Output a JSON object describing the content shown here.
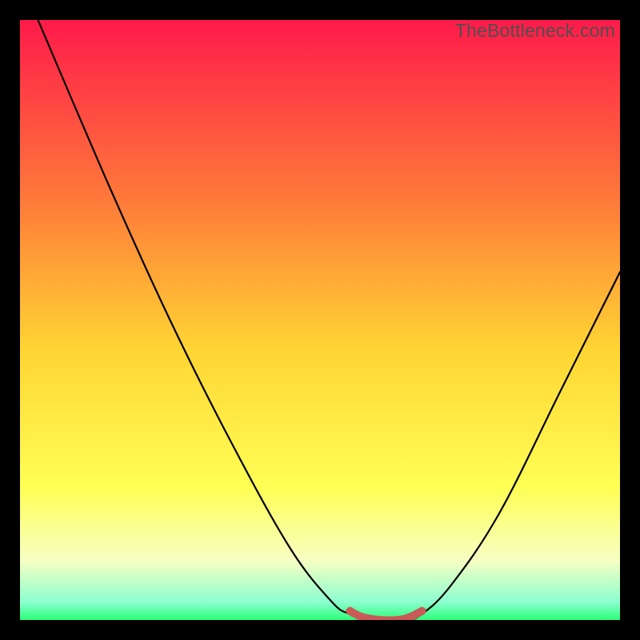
{
  "watermark": "TheBottleneck.com",
  "colors": {
    "frame": "#000000",
    "gradient_top": "#ff1a4a",
    "gradient_mid_upper": "#ff7a3a",
    "gradient_mid": "#ffd533",
    "gradient_mid_lower": "#ffff55",
    "gradient_lower": "#f7ffc2",
    "gradient_bottom": "#2cff79",
    "curve": "#000000",
    "marker": "#c85a57"
  },
  "chart_data": {
    "type": "line",
    "title": "",
    "xlabel": "",
    "ylabel": "",
    "xlim": [
      0,
      100
    ],
    "ylim": [
      0,
      100
    ],
    "curve": [
      {
        "x": 3,
        "y": 100
      },
      {
        "x": 15,
        "y": 72
      },
      {
        "x": 25,
        "y": 50
      },
      {
        "x": 35,
        "y": 30
      },
      {
        "x": 45,
        "y": 12
      },
      {
        "x": 52,
        "y": 3
      },
      {
        "x": 55,
        "y": 1
      },
      {
        "x": 58,
        "y": 0
      },
      {
        "x": 64,
        "y": 0
      },
      {
        "x": 67,
        "y": 1
      },
      {
        "x": 72,
        "y": 6
      },
      {
        "x": 80,
        "y": 18
      },
      {
        "x": 90,
        "y": 38
      },
      {
        "x": 100,
        "y": 58
      }
    ],
    "highlight_segment": [
      {
        "x": 55,
        "y": 1.5
      },
      {
        "x": 57,
        "y": 0.5
      },
      {
        "x": 60,
        "y": 0
      },
      {
        "x": 63,
        "y": 0
      },
      {
        "x": 65,
        "y": 0.5
      },
      {
        "x": 67,
        "y": 1.5
      }
    ],
    "gradient_stops": [
      {
        "pos": 0.0,
        "color": "#ff1a4a"
      },
      {
        "pos": 0.3,
        "color": "#ff7a3a"
      },
      {
        "pos": 0.55,
        "color": "#ffd533"
      },
      {
        "pos": 0.78,
        "color": "#ffff55"
      },
      {
        "pos": 0.9,
        "color": "#f7ffc2"
      },
      {
        "pos": 0.97,
        "color": "#8cffd0"
      },
      {
        "pos": 1.0,
        "color": "#2cff79"
      }
    ]
  }
}
